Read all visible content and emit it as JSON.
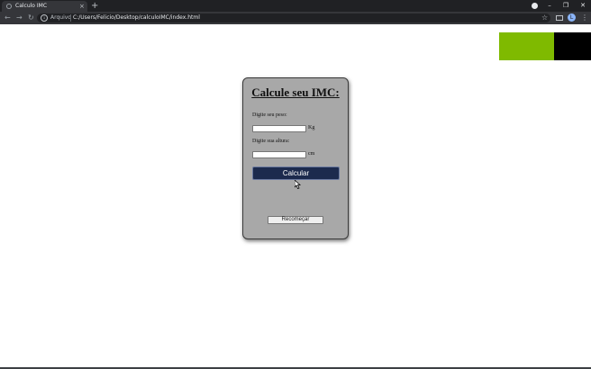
{
  "browser": {
    "tab_title": "Calculo IMC",
    "new_tab_symbol": "+",
    "close_tab_symbol": "×",
    "url_scheme_label": "Arquivo",
    "url_path": "C:/Users/Felicio/Desktop/calculoIMC/index.html",
    "avatar_letter": "L",
    "window_controls": [
      "–",
      "❐",
      "✕"
    ],
    "nav_icons": [
      "back-arrow-icon",
      "forward-arrow-icon",
      "reload-icon"
    ],
    "toolbar_icons": [
      "star-icon",
      "extension-icon",
      "avatar",
      "menu-icon"
    ]
  },
  "page": {
    "decor_colors": {
      "green": "#7fba00",
      "black": "#000000"
    },
    "card": {
      "title": "Calcule seu IMC:",
      "weight_label": "Digite seu peso:",
      "weight_value": "",
      "weight_unit": "Kg",
      "height_label": "Digite sua altura:",
      "height_value": "",
      "height_unit": "cm",
      "calc_button": "Calcular",
      "reset_button": "Recomeçar"
    },
    "colors": {
      "card_background": "#a8a8a8",
      "calc_button_background": "#1c2a4d"
    }
  }
}
